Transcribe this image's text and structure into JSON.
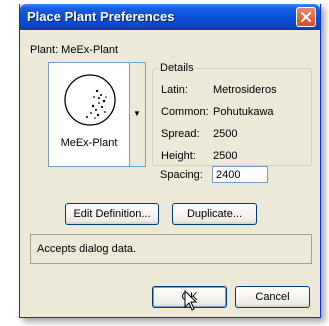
{
  "window": {
    "title": "Place Plant Preferences"
  },
  "plant": {
    "label": "Plant: MeEx-Plant",
    "preview_caption": "MeEx-Plant"
  },
  "details": {
    "legend": "Details",
    "latin_label": "Latin:",
    "latin_value": "Metrosideros",
    "common_label": "Common:",
    "common_value": "Pohutukawa",
    "spread_label": "Spread:",
    "spread_value": "2500",
    "height_label": "Height:",
    "height_value": "2500",
    "spacing_label": "Spacing:",
    "spacing_value": "2400"
  },
  "buttons": {
    "edit_definition": "Edit Definition...",
    "duplicate": "Duplicate...",
    "ok": "OK",
    "cancel": "Cancel"
  },
  "status": {
    "text": "Accepts dialog data."
  },
  "icons": {
    "close": "close-icon",
    "dropdown": "chevron-down-icon",
    "plant_preview": "plant-symbol-icon",
    "cursor": "mouse-pointer-icon"
  },
  "colors": {
    "titlebar": "#0a4fd8",
    "dialog_bg": "#ece9d8",
    "close_button": "#d64a22"
  }
}
